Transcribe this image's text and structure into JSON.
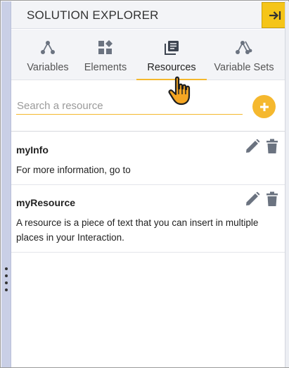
{
  "header": {
    "title": "SOLUTION EXPLORER",
    "collapse_icon": "arrow-right-to-bar-icon"
  },
  "tabs": [
    {
      "label": "Variables",
      "icon": "variables-icon"
    },
    {
      "label": "Elements",
      "icon": "elements-icon"
    },
    {
      "label": "Resources",
      "icon": "resources-icon",
      "active": true
    },
    {
      "label": "Variable Sets",
      "icon": "variable-sets-icon"
    }
  ],
  "search": {
    "placeholder": "Search a resource",
    "value": ""
  },
  "resources": [
    {
      "name": "myInfo",
      "description": "For more information, go to"
    },
    {
      "name": "myResource",
      "description": "A resource is a piece of text that you can insert in multiple places in your Interaction."
    }
  ],
  "colors": {
    "accent": "#f5b82e",
    "collapse_button": "#f5c518",
    "header_bg": "#f3f4f7",
    "rail": "#c9cfe6",
    "icon": "#6b7380"
  }
}
